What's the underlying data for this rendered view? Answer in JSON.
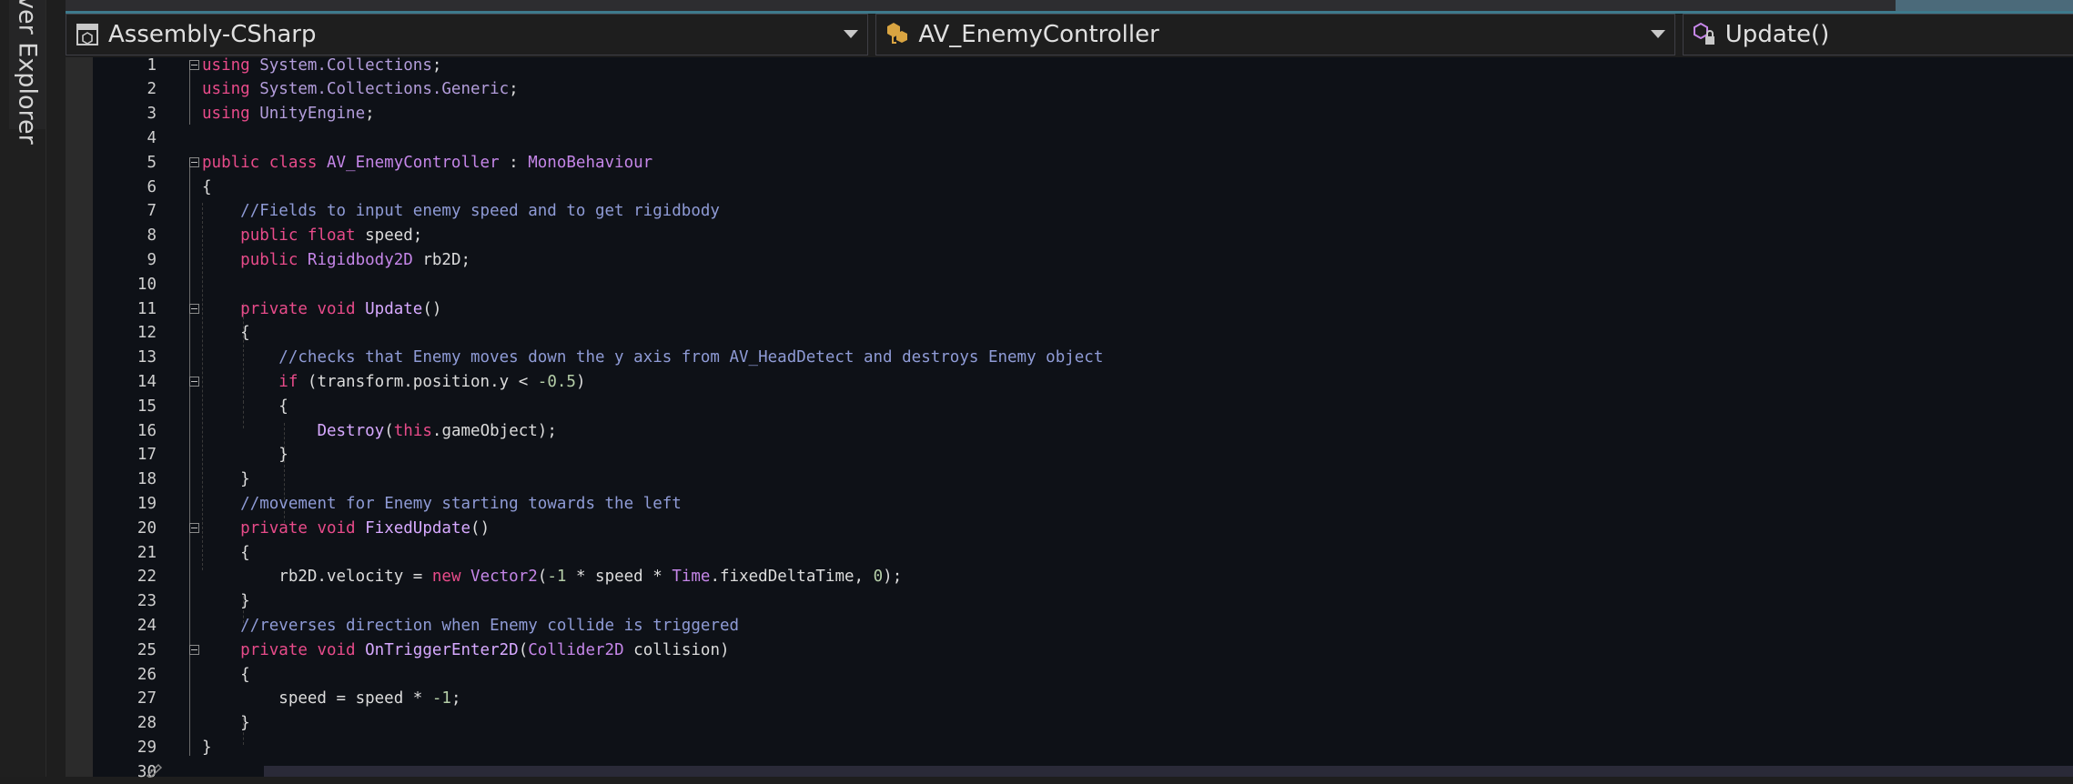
{
  "side_panel": {
    "label": "ver Explorer"
  },
  "navbar": {
    "project": "Assembly-CSharp",
    "class_name": "AV_EnemyController",
    "member": "Update()"
  },
  "colors": {
    "keyword": "#e84b8a",
    "type": "#c586e8",
    "comment": "#8f9bd6",
    "number": "#b5cea8",
    "background": "#0e1117"
  },
  "code_lines": [
    {
      "n": "1",
      "tokens": [
        [
          "kw",
          "using "
        ],
        [
          "ns",
          "System.Collections"
        ],
        [
          "",
          "; "
        ]
      ]
    },
    {
      "n": "2",
      "tokens": [
        [
          "kw",
          "using "
        ],
        [
          "ns",
          "System.Collections.Generic"
        ],
        [
          "",
          ";"
        ]
      ]
    },
    {
      "n": "3",
      "tokens": [
        [
          "kw",
          "using "
        ],
        [
          "ns",
          "UnityEngine"
        ],
        [
          "",
          ";"
        ]
      ]
    },
    {
      "n": "4",
      "tokens": []
    },
    {
      "n": "5",
      "tokens": [
        [
          "kw",
          "public class "
        ],
        [
          "ty",
          "AV_EnemyController"
        ],
        [
          "",
          " : "
        ],
        [
          "ty",
          "MonoBehaviour"
        ]
      ]
    },
    {
      "n": "6",
      "tokens": [
        [
          "",
          "{"
        ]
      ]
    },
    {
      "n": "7",
      "tokens": [
        [
          "",
          "    "
        ],
        [
          "cm",
          "//Fields to input enemy speed and to get rigidbody"
        ]
      ]
    },
    {
      "n": "8",
      "tokens": [
        [
          "",
          "    "
        ],
        [
          "kw",
          "public float "
        ],
        [
          "",
          "speed;"
        ]
      ]
    },
    {
      "n": "9",
      "tokens": [
        [
          "",
          "    "
        ],
        [
          "kw",
          "public "
        ],
        [
          "ty",
          "Rigidbody2D "
        ],
        [
          "",
          "rb2D;"
        ]
      ]
    },
    {
      "n": "10",
      "tokens": []
    },
    {
      "n": "11",
      "tokens": [
        [
          "",
          "    "
        ],
        [
          "kw",
          "private void "
        ],
        [
          "fn",
          "Update"
        ],
        [
          "",
          "()"
        ]
      ]
    },
    {
      "n": "12",
      "tokens": [
        [
          "",
          "    {"
        ]
      ]
    },
    {
      "n": "13",
      "tokens": [
        [
          "",
          "        "
        ],
        [
          "cm",
          "//checks that Enemy moves down the y axis from AV_HeadDetect and destroys Enemy object"
        ]
      ]
    },
    {
      "n": "14",
      "tokens": [
        [
          "",
          "        "
        ],
        [
          "kw",
          "if "
        ],
        [
          "",
          "(transform.position.y < "
        ],
        [
          "num",
          "-0.5"
        ],
        [
          "",
          ")"
        ]
      ]
    },
    {
      "n": "15",
      "tokens": [
        [
          "",
          "        {"
        ]
      ]
    },
    {
      "n": "16",
      "tokens": [
        [
          "",
          "            "
        ],
        [
          "fn",
          "Destroy"
        ],
        [
          "",
          "("
        ],
        [
          "kw",
          "this"
        ],
        [
          "",
          ".gameObject);"
        ]
      ]
    },
    {
      "n": "17",
      "tokens": [
        [
          "",
          "        }"
        ]
      ]
    },
    {
      "n": "18",
      "tokens": [
        [
          "",
          "    }"
        ]
      ]
    },
    {
      "n": "19",
      "tokens": [
        [
          "",
          "    "
        ],
        [
          "cm",
          "//movement for Enemy starting towards the left"
        ]
      ]
    },
    {
      "n": "20",
      "tokens": [
        [
          "",
          "    "
        ],
        [
          "kw",
          "private void "
        ],
        [
          "fn",
          "FixedUpdate"
        ],
        [
          "",
          "()"
        ]
      ]
    },
    {
      "n": "21",
      "tokens": [
        [
          "",
          "    {"
        ]
      ]
    },
    {
      "n": "22",
      "tokens": [
        [
          "",
          "        rb2D.velocity = "
        ],
        [
          "kw",
          "new "
        ],
        [
          "ty",
          "Vector2"
        ],
        [
          "",
          "("
        ],
        [
          "num",
          "-1"
        ],
        [
          "",
          " * speed * "
        ],
        [
          "ty",
          "Time"
        ],
        [
          "",
          ".fixedDeltaTime, "
        ],
        [
          "num",
          "0"
        ],
        [
          "",
          ");"
        ]
      ]
    },
    {
      "n": "23",
      "tokens": [
        [
          "",
          "    }"
        ]
      ]
    },
    {
      "n": "24",
      "tokens": [
        [
          "",
          "    "
        ],
        [
          "cm",
          "//reverses direction when Enemy collide is triggered"
        ]
      ]
    },
    {
      "n": "25",
      "tokens": [
        [
          "",
          "    "
        ],
        [
          "kw",
          "private void "
        ],
        [
          "fn",
          "OnTriggerEnter2D"
        ],
        [
          "",
          "("
        ],
        [
          "ty",
          "Collider2D "
        ],
        [
          "",
          "collision)"
        ]
      ]
    },
    {
      "n": "26",
      "tokens": [
        [
          "",
          "    {"
        ]
      ]
    },
    {
      "n": "27",
      "tokens": [
        [
          "",
          "        speed = speed * "
        ],
        [
          "num",
          "-1"
        ],
        [
          "",
          ";"
        ]
      ]
    },
    {
      "n": "28",
      "tokens": [
        [
          "",
          "    }"
        ]
      ]
    },
    {
      "n": "29",
      "tokens": [
        [
          "",
          "}"
        ]
      ]
    },
    {
      "n": "30",
      "tokens": []
    }
  ]
}
